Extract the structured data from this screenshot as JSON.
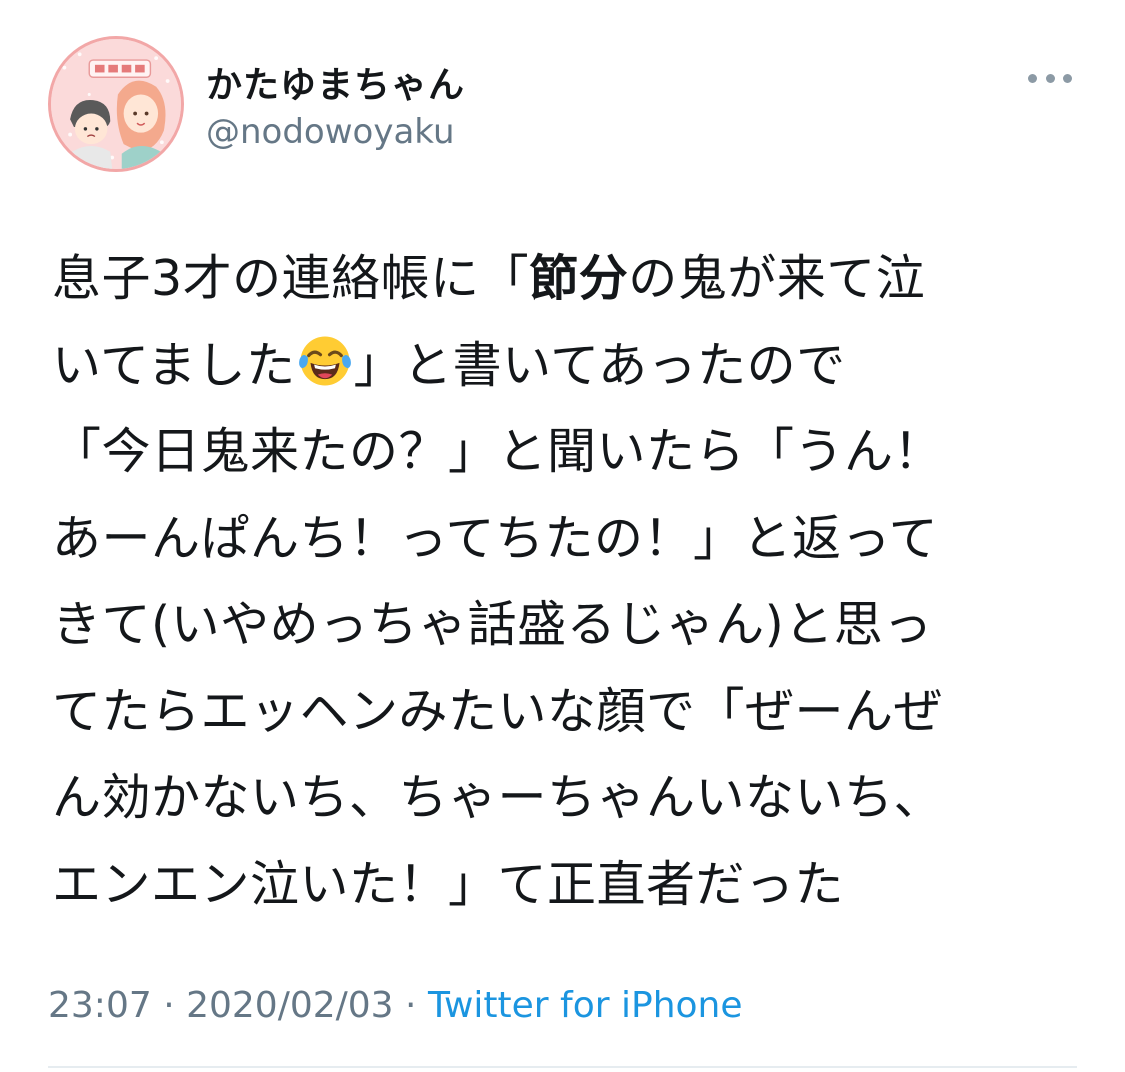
{
  "user": {
    "display_name": "かたゆまちゃん",
    "handle": "@nodowoyaku"
  },
  "tweet": {
    "lines": [
      {
        "parts": [
          {
            "text": "息子3才の連絡帳に「",
            "bold": false
          },
          {
            "text": "節分",
            "bold": true
          },
          {
            "text": "の鬼が来て泣",
            "bold": false
          }
        ]
      },
      {
        "parts": [
          {
            "text": "いてました",
            "bold": false
          },
          {
            "emoji": "face-with-tears-of-joy"
          },
          {
            "text": "」と書いてあったので",
            "bold": false
          }
        ]
      },
      {
        "parts": [
          {
            "text": "「今日鬼来たの？」と聞いたら「うん！",
            "bold": false
          }
        ]
      },
      {
        "parts": [
          {
            "text": "あーんぱんち！ってちたの！」と返って",
            "bold": false
          }
        ]
      },
      {
        "parts": [
          {
            "text": "きて(いやめっちゃ話盛るじゃん)と思っ",
            "bold": false
          }
        ]
      },
      {
        "parts": [
          {
            "text": "てたらエッヘンみたいな顔で「ぜーんぜ",
            "bold": false
          }
        ]
      },
      {
        "parts": [
          {
            "text": "ん効かないち、ちゃーちゃんいないち、",
            "bold": false
          }
        ]
      },
      {
        "parts": [
          {
            "text": "エンエン泣いた！」て正直者だった",
            "bold": false
          }
        ]
      }
    ]
  },
  "meta": {
    "time": "23:07",
    "separator1": " · ",
    "date": "2020/02/03",
    "separator2": " · ",
    "source": "Twitter for iPhone"
  },
  "icons": {
    "more": "more-horizontal-icon",
    "emoji": "face-with-tears-of-joy-emoji"
  },
  "colors": {
    "text": "#14171a",
    "secondary": "#657786",
    "link": "#1b95e0",
    "divider": "#e6ecf0"
  }
}
